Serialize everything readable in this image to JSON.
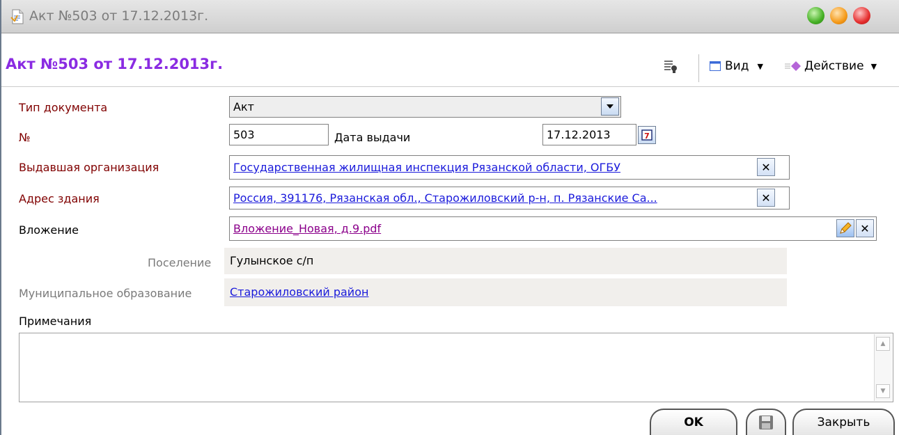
{
  "window": {
    "title": "Акт №503 от 17.12.2013г."
  },
  "header": {
    "title": "Акт №503 от 17.12.2013г.",
    "view_label": "Вид",
    "action_label": "Действие"
  },
  "form": {
    "doc_type": {
      "label": "Тип документа",
      "value": "Акт"
    },
    "number": {
      "label": "№",
      "value": "503"
    },
    "issue_date": {
      "label": "Дата выдачи",
      "value": "17.12.2013"
    },
    "issuer": {
      "label": "Выдавшая организация",
      "value": "Государственная жилищная инспекция Рязанской области, ОГБУ"
    },
    "address": {
      "label": "Адрес здания",
      "value": "Россия, 391176, Рязанская обл., Старожиловский р-н, п. Рязанские Са..."
    },
    "attachment": {
      "label": "Вложение",
      "value": "Вложение_Новая, д.9.pdf"
    },
    "settlement": {
      "label": "Поселение",
      "value": "Гулынское с/п"
    },
    "municipality": {
      "label": "Муниципальное образование",
      "value": "Старожиловский район"
    },
    "notes": {
      "label": "Примечания",
      "value": ""
    }
  },
  "footer": {
    "ok_label": "OK",
    "close_label": "Закрыть"
  },
  "colors": {
    "title_accent": "#8a2be2",
    "required_label": "#800000",
    "link": "#1a1adb"
  }
}
